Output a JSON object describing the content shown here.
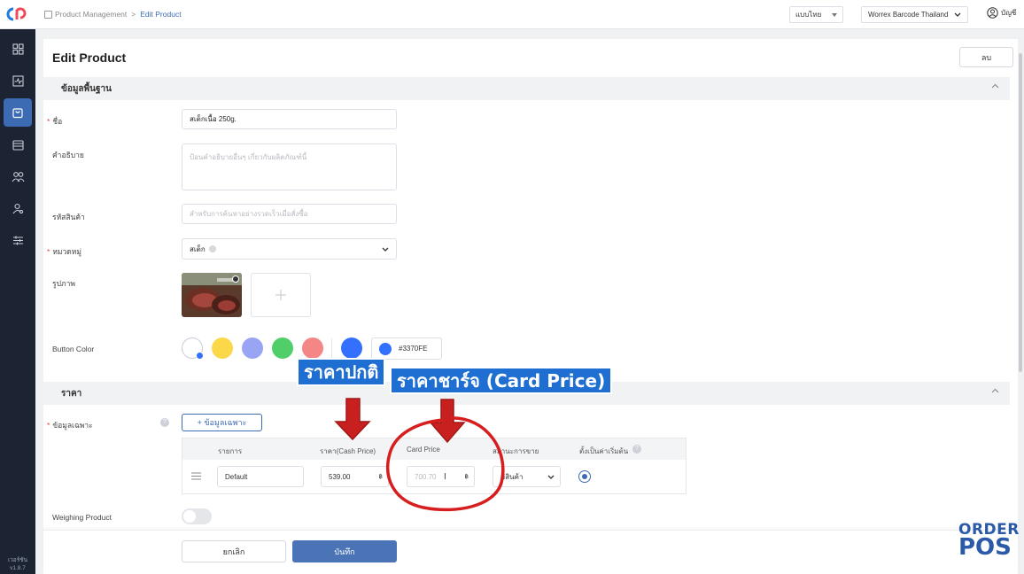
{
  "topbar": {
    "breadcrumb_root": "Product Management",
    "breadcrumb_sep": ">",
    "breadcrumb_current": "Edit Product",
    "language": "แบบไทย",
    "company": "Worrex Barcode Thailand",
    "account": "บัญชี"
  },
  "sidebar": {
    "version_label": "เวอร์ชัน",
    "version": "v1.8.7"
  },
  "page": {
    "title": "Edit Product",
    "delete_label": "ลบ"
  },
  "basic": {
    "section_title": "ข้อมูลพื้นฐาน",
    "name_label": "ชื่อ",
    "name_value": "สเต็กเนื้อ 250g.",
    "desc_label": "คำอธิบาย",
    "desc_placeholder": "ป้อนคำอธิบายอื่นๆ เกี่ยวกับผลิตภัณฑ์นี้",
    "code_label": "รหัสสินค้า",
    "code_placeholder": "สำหรับการค้นหาอย่างรวดเร็วเมื่อสั่งซื้อ",
    "category_label": "หมวดหมู่",
    "category_value": "สเต็ก",
    "image_label": "รูปภาพ",
    "color_label": "Button Color",
    "color_hex": "#3370FE",
    "swatches": [
      "#ffffff",
      "#fbd84a",
      "#9aa4f5",
      "#4fce6a",
      "#f48686",
      "#3370fe"
    ]
  },
  "price": {
    "section_title": "ราคา",
    "spec_label": "ข้อมูลเฉพาะ",
    "add_spec_label": "+ ข้อมูลเฉพาะ",
    "columns": [
      "รายการ",
      "ราคา(Cash Price)",
      "Card Price",
      "สถานะการขาย",
      "ตั้งเป็นค่าเริ่มต้น"
    ],
    "row": {
      "item": "Default",
      "cash_price": "539.00",
      "card_price": "700.70",
      "currency": "฿",
      "status": "มีสินค้า"
    },
    "weighing_label": "Weighing Product"
  },
  "footer": {
    "cancel_label": "ยกเลิก",
    "save_label": "บันทึก"
  },
  "overlay": {
    "callout_cash": "ราคาปกติ",
    "callout_card": "ราคาชาร์จ (Card Price)",
    "brand_top": "ORDER",
    "brand_bottom": "POS"
  }
}
